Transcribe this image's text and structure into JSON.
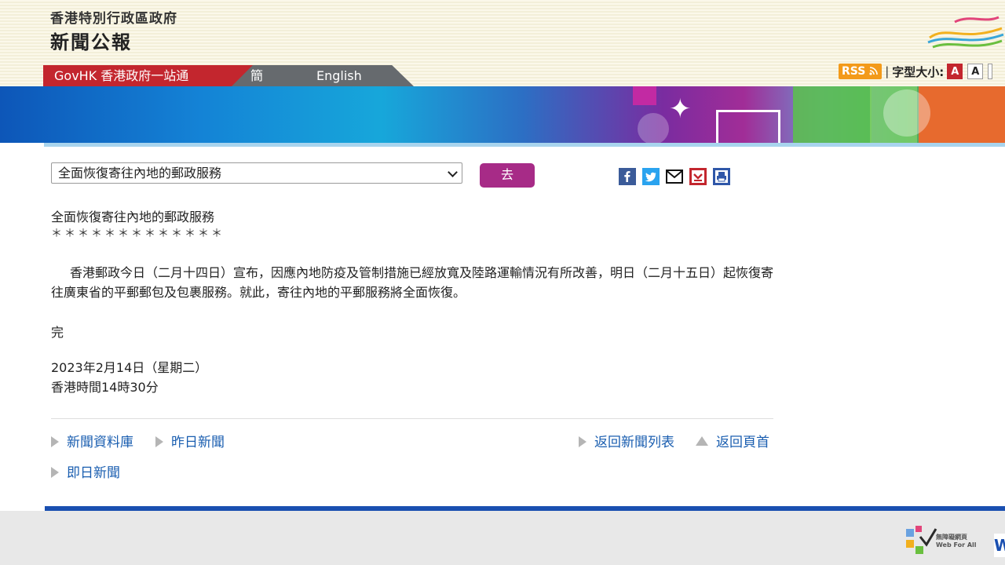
{
  "header": {
    "gov_title": "香港特別行政區政府",
    "press_title": "新聞公報"
  },
  "nav": {
    "govhk": "GovHK 香港政府一站通",
    "simplified": "簡体版",
    "english": "English"
  },
  "tools": {
    "rss": "RSS",
    "separator": "|",
    "font_size_label": "字型大小:",
    "font_small": "A",
    "font_large": "A"
  },
  "selector": {
    "selected": "全面恢復寄往內地的郵政服務",
    "go_label": "去"
  },
  "share_icons": [
    "facebook-icon",
    "twitter-icon",
    "email-icon",
    "bookmark-icon",
    "print-icon"
  ],
  "article": {
    "title": "全面恢復寄往內地的郵政服務",
    "stars": "＊＊＊＊＊＊＊＊＊＊＊＊＊",
    "body": "香港郵政今日（二月十四日）宣布，因應內地防疫及管制措施已經放寬及陸路運輸情況有所改善，明日（二月十五日）起恢復寄往廣東省的平郵郵包及包裹服務。就此，寄往內地的平郵服務將全面恢復。",
    "end": "完",
    "date": "2023年2月14日（星期二）",
    "time": "香港時間14時30分"
  },
  "links": {
    "archive": "新聞資料庫",
    "yesterday": "昨日新聞",
    "today": "即日新聞",
    "back_list": "返回新聞列表",
    "back_top": "返回頁首"
  },
  "colors": {
    "brand_red": "#c3262e",
    "go_button": "#a72b87",
    "link_blue": "#1a5eb0",
    "footer_blue": "#1a4fb0"
  }
}
